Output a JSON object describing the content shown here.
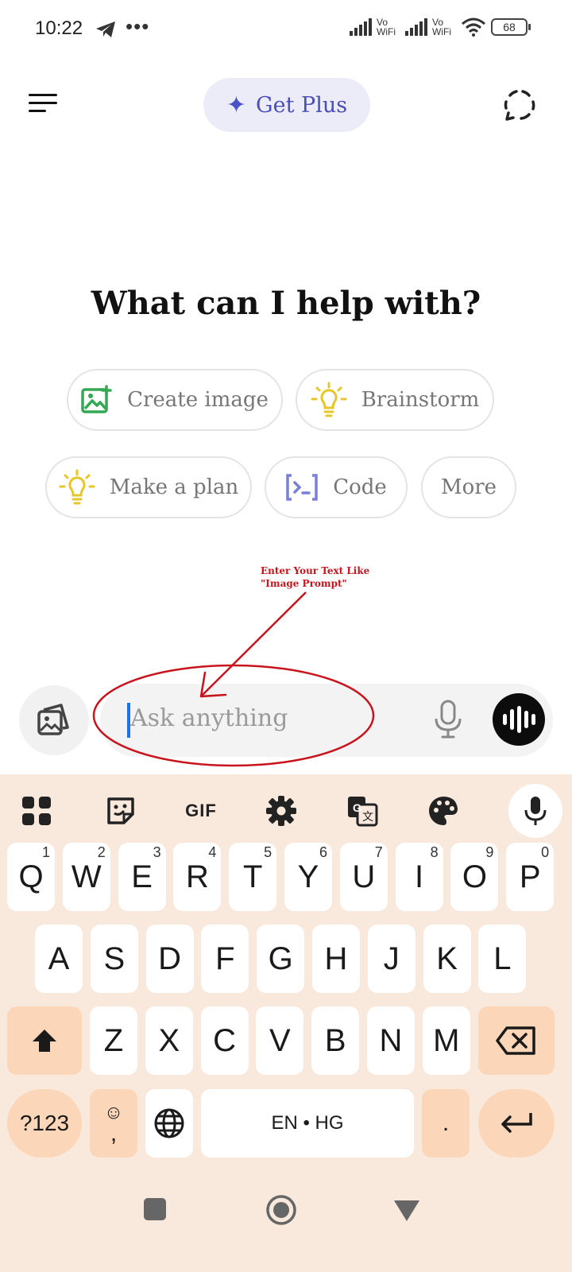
{
  "status_bar": {
    "time": "10:22",
    "more_dots": "•••",
    "vowifi_1": "Vo WiFi",
    "vowifi_2": "Vo WiFi",
    "battery": "68"
  },
  "header": {
    "menu_icon": "menu-icon",
    "get_plus_label": "Get Plus",
    "temp_chat_icon": "temporary-chat-icon"
  },
  "main": {
    "headline": "What can I help with?",
    "chips": [
      {
        "label": "Create image",
        "icon": "image-add-icon",
        "color": "#34a853"
      },
      {
        "label": "Brainstorm",
        "icon": "lightbulb-icon",
        "color": "#e6c629"
      },
      {
        "label": "Make a plan",
        "icon": "lightbulb-icon",
        "color": "#e6c629"
      },
      {
        "label": "Code",
        "icon": "code-icon",
        "color": "#7a7fd8"
      },
      {
        "label": "More",
        "icon": "",
        "color": ""
      }
    ]
  },
  "annotation": {
    "line1": "Enter Your Text Like",
    "line2": "\"Image Prompt\"",
    "color": "#c8141c"
  },
  "composer": {
    "placeholder": "Ask anything",
    "attach_icon": "image-attach-icon",
    "mic_icon": "mic-icon",
    "voice_icon": "voice-mode-icon"
  },
  "keyboard": {
    "toolbar": [
      "apps-grid-icon",
      "sticker-icon",
      "GIF",
      "settings-icon",
      "translate-icon",
      "palette-icon",
      "mic-icon"
    ],
    "gif_label": "GIF",
    "row1": [
      {
        "k": "Q",
        "h": "1"
      },
      {
        "k": "W",
        "h": "2"
      },
      {
        "k": "E",
        "h": "3"
      },
      {
        "k": "R",
        "h": "4"
      },
      {
        "k": "T",
        "h": "5"
      },
      {
        "k": "Y",
        "h": "6"
      },
      {
        "k": "U",
        "h": "7"
      },
      {
        "k": "I",
        "h": "8"
      },
      {
        "k": "O",
        "h": "9"
      },
      {
        "k": "P",
        "h": "0"
      }
    ],
    "row2": [
      "A",
      "S",
      "D",
      "F",
      "G",
      "H",
      "J",
      "K",
      "L"
    ],
    "row3": [
      "Z",
      "X",
      "C",
      "V",
      "B",
      "N",
      "M"
    ],
    "sym_label": "?123",
    "emoji_label": "☺",
    "comma_label": ",",
    "space_label": "EN • HG",
    "period_label": ".",
    "bg_color": "#f9e8dc",
    "fn_color": "#fbd6b8"
  }
}
